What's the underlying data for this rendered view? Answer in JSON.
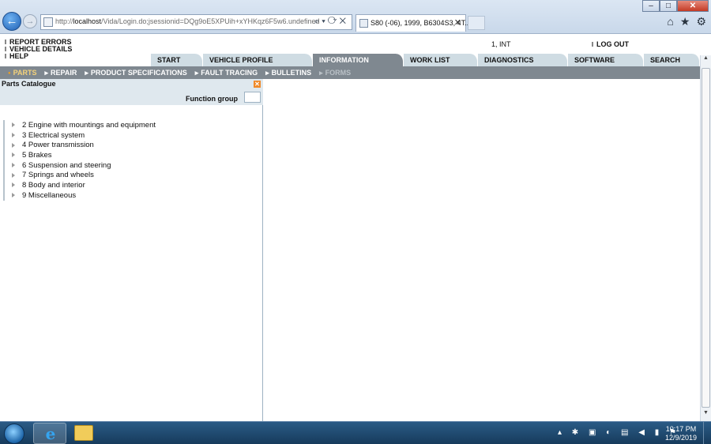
{
  "browser": {
    "url_prefix": "http://",
    "url_host": "localhost",
    "url_rest": "/Vida/Login.do;jsessionid=DQg9oE5XPUih+xYHKqz6F5w6.undefined",
    "tab_title": "S80 (-06), 1999, B6304S3, 4T...",
    "back_icon": "back-arrow-icon",
    "forward_icon": "forward-arrow-icon"
  },
  "top_menu": [
    "REPORT ERRORS",
    "VEHICLE DETAILS",
    "HELP"
  ],
  "user": "1, INT",
  "logout_label": "LOG OUT",
  "main_tabs": [
    {
      "label": "START",
      "active": false
    },
    {
      "label": "VEHICLE PROFILE",
      "active": false
    },
    {
      "label": "INFORMATION",
      "active": true
    },
    {
      "label": "WORK LIST",
      "active": false
    },
    {
      "label": "DIAGNOSTICS",
      "active": false
    },
    {
      "label": "SOFTWARE",
      "active": false
    },
    {
      "label": "SEARCH",
      "active": false
    }
  ],
  "sub_tabs": [
    {
      "label": "PARTS",
      "state": "active"
    },
    {
      "label": "REPAIR",
      "state": "normal"
    },
    {
      "label": "PRODUCT SPECIFICATIONS",
      "state": "normal"
    },
    {
      "label": "FAULT TRACING",
      "state": "normal"
    },
    {
      "label": "BULLETINS",
      "state": "normal"
    },
    {
      "label": "FORMS",
      "state": "disabled"
    }
  ],
  "panel": {
    "title": "Parts Catalogue",
    "function_group_label": "Function group",
    "function_group_value": "",
    "items": [
      "2 Engine with mountings and equipment",
      "3 Electrical system",
      "4 Power transmission",
      "5 Brakes",
      "6 Suspension and steering",
      "7 Springs and wheels",
      "8 Body and interior",
      "9 Miscellaneous"
    ]
  },
  "taskbar": {
    "time": "10:17 PM",
    "date": "12/9/2019"
  },
  "colors": {
    "tab_active": "#7f8890",
    "tab_inactive": "#cfdce3",
    "panel_head": "#dfe8ee",
    "parts_highlight": "#f0a020"
  }
}
